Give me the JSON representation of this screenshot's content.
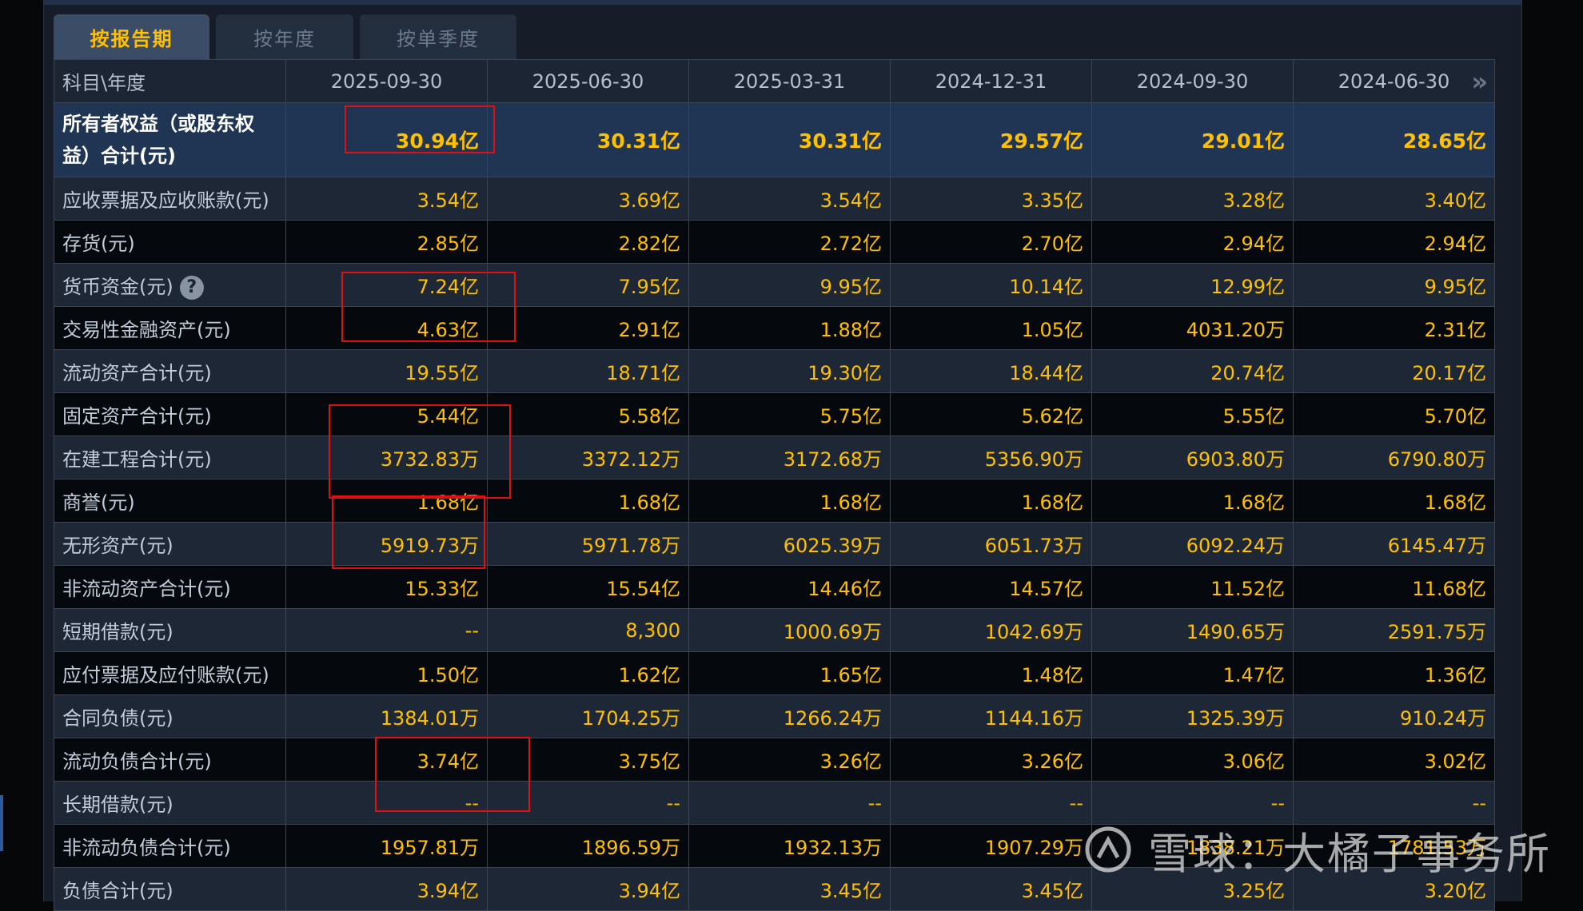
{
  "tabs": [
    "按报告期",
    "按年度",
    "按单季度"
  ],
  "table": {
    "subject_header": "科目\\年度",
    "periods": [
      "2025-09-30",
      "2025-06-30",
      "2025-03-31",
      "2024-12-31",
      "2024-09-30",
      "2024-06-30"
    ],
    "rows": [
      {
        "label": "所有者权益（或股东权益）合计(元)",
        "values": [
          "30.94亿",
          "30.31亿",
          "30.31亿",
          "29.57亿",
          "29.01亿",
          "28.65亿"
        ]
      },
      {
        "label": "应收票据及应收账款(元)",
        "values": [
          "3.54亿",
          "3.69亿",
          "3.54亿",
          "3.35亿",
          "3.28亿",
          "3.40亿"
        ]
      },
      {
        "label": "存货(元)",
        "values": [
          "2.85亿",
          "2.82亿",
          "2.72亿",
          "2.70亿",
          "2.94亿",
          "2.94亿"
        ]
      },
      {
        "label": "货币资金(元)",
        "values": [
          "7.24亿",
          "7.95亿",
          "9.95亿",
          "10.14亿",
          "12.99亿",
          "9.95亿"
        ]
      },
      {
        "label": "交易性金融资产(元)",
        "values": [
          "4.63亿",
          "2.91亿",
          "1.88亿",
          "1.05亿",
          "4031.20万",
          "2.31亿"
        ]
      },
      {
        "label": "流动资产合计(元)",
        "values": [
          "19.55亿",
          "18.71亿",
          "19.30亿",
          "18.44亿",
          "20.74亿",
          "20.17亿"
        ]
      },
      {
        "label": "固定资产合计(元)",
        "values": [
          "5.44亿",
          "5.58亿",
          "5.75亿",
          "5.62亿",
          "5.55亿",
          "5.70亿"
        ]
      },
      {
        "label": "在建工程合计(元)",
        "values": [
          "3732.83万",
          "3372.12万",
          "3172.68万",
          "5356.90万",
          "6903.80万",
          "6790.80万"
        ]
      },
      {
        "label": "商誉(元)",
        "values": [
          "1.68亿",
          "1.68亿",
          "1.68亿",
          "1.68亿",
          "1.68亿",
          "1.68亿"
        ]
      },
      {
        "label": "无形资产(元)",
        "values": [
          "5919.73万",
          "5971.78万",
          "6025.39万",
          "6051.73万",
          "6092.24万",
          "6145.47万"
        ]
      },
      {
        "label": "非流动资产合计(元)",
        "values": [
          "15.33亿",
          "15.54亿",
          "14.46亿",
          "14.57亿",
          "11.52亿",
          "11.68亿"
        ]
      },
      {
        "label": "短期借款(元)",
        "values": [
          "--",
          "8,300",
          "1000.69万",
          "1042.69万",
          "1490.65万",
          "2591.75万"
        ]
      },
      {
        "label": "应付票据及应付账款(元)",
        "values": [
          "1.50亿",
          "1.62亿",
          "1.65亿",
          "1.48亿",
          "1.47亿",
          "1.36亿"
        ]
      },
      {
        "label": "合同负债(元)",
        "values": [
          "1384.01万",
          "1704.25万",
          "1266.24万",
          "1144.16万",
          "1325.39万",
          "910.24万"
        ]
      },
      {
        "label": "流动负债合计(元)",
        "values": [
          "3.74亿",
          "3.75亿",
          "3.26亿",
          "3.26亿",
          "3.06亿",
          "3.02亿"
        ]
      },
      {
        "label": "长期借款(元)",
        "values": [
          "--",
          "--",
          "--",
          "--",
          "--",
          "--"
        ]
      },
      {
        "label": "非流动负债合计(元)",
        "values": [
          "1957.81万",
          "1896.59万",
          "1932.13万",
          "1907.29万",
          "1838.21万",
          "1781.53万"
        ]
      },
      {
        "label": "负债合计(元)",
        "values": [
          "3.94亿",
          "3.94亿",
          "3.45亿",
          "3.45亿",
          "3.25亿",
          "3.20亿"
        ]
      }
    ]
  },
  "watermark": "雪球：大橘子事务所",
  "colors": {
    "value": "#ffc000",
    "highlight_box": "#e01010",
    "active_tab_bg": "#3a4c66"
  },
  "icons": [
    "help-icon",
    "chevron-right-icon",
    "xueqiu-logo"
  ]
}
